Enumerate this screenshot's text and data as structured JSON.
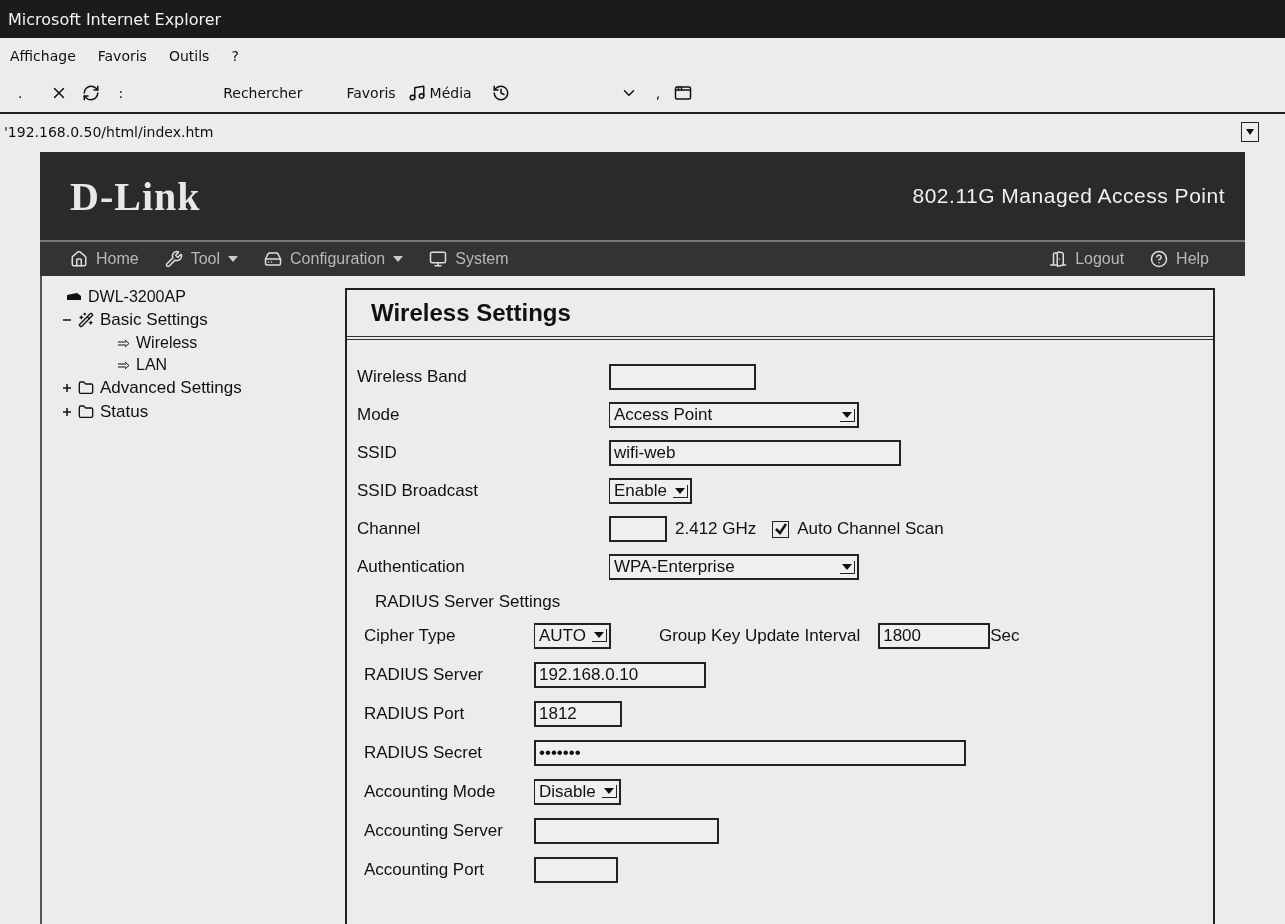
{
  "window": {
    "title": "Microsoft Internet Explorer"
  },
  "menu": [
    {
      "label": "Affichage"
    },
    {
      "label": "Favoris"
    },
    {
      "label": "Outils"
    },
    {
      "label": "?"
    }
  ],
  "toolbar": [
    {
      "kind": "text",
      "label": "."
    },
    {
      "kind": "stop"
    },
    {
      "kind": "refresh"
    },
    {
      "kind": "text",
      "label": ":"
    },
    {
      "kind": "text",
      "label": "Rechercher"
    },
    {
      "kind": "text",
      "label": "Favoris"
    },
    {
      "kind": "media",
      "label": "Média"
    },
    {
      "kind": "history"
    },
    {
      "kind": "caret"
    },
    {
      "kind": "text",
      "label": ","
    },
    {
      "kind": "window"
    }
  ],
  "address": {
    "value": "'192.168.0.50/html/index.htm"
  },
  "header": {
    "logo": "D-Link",
    "product": "802.11G Managed Access Point"
  },
  "nav": [
    {
      "kind": "home",
      "label": "Home",
      "dropdown": false
    },
    {
      "kind": "tool",
      "label": "Tool",
      "dropdown": true
    },
    {
      "kind": "config",
      "label": "Configuration",
      "dropdown": true
    },
    {
      "kind": "system",
      "label": "System",
      "dropdown": false
    }
  ],
  "nav_right": [
    {
      "kind": "logout",
      "label": "Logout"
    },
    {
      "kind": "help",
      "label": "Help"
    }
  ],
  "tree": {
    "root": "DWL-3200AP",
    "items": [
      {
        "label": "Basic Settings",
        "expanded": true,
        "children": [
          {
            "label": "Wireless"
          },
          {
            "label": "LAN"
          }
        ]
      },
      {
        "label": "Advanced Settings",
        "expanded": false
      },
      {
        "label": "Status",
        "expanded": false
      }
    ]
  },
  "panel": {
    "title": "Wireless Settings",
    "rows": [
      {
        "kind": "text",
        "label": "Wireless Band"
      },
      {
        "kind": "select",
        "label": "Mode",
        "value": "Access Point"
      },
      {
        "kind": "text",
        "label": "SSID",
        "value": "wifi-web"
      },
      {
        "kind": "select",
        "label": "SSID Broadcast",
        "value": "Enable"
      },
      {
        "kind": "channel",
        "label": "Channel",
        "frequency": "2.412 GHz",
        "auto_scan": {
          "label": "Auto Channel Scan",
          "checked": true
        }
      },
      {
        "kind": "select",
        "label": "Authentication",
        "value": "WPA-Enterprise"
      }
    ],
    "radius": {
      "title": "RADIUS Server Settings",
      "rows": [
        {
          "kind": "cipher",
          "label": "Cipher Type",
          "value": "AUTO",
          "interval_label": "Group Key Update Interval",
          "interval": "1800",
          "unit": "Sec"
        },
        {
          "kind": "text",
          "label": "RADIUS Server",
          "value": "192.168.0.10"
        },
        {
          "kind": "text",
          "label": "RADIUS Port",
          "value": "1812"
        },
        {
          "kind": "text",
          "label": "RADIUS Secret",
          "value": "•••••••"
        },
        {
          "kind": "select",
          "label": "Accounting Mode",
          "value": "Disable"
        },
        {
          "kind": "text",
          "label": "Accounting Server"
        },
        {
          "kind": "text",
          "label": "Accounting Port"
        }
      ]
    }
  }
}
